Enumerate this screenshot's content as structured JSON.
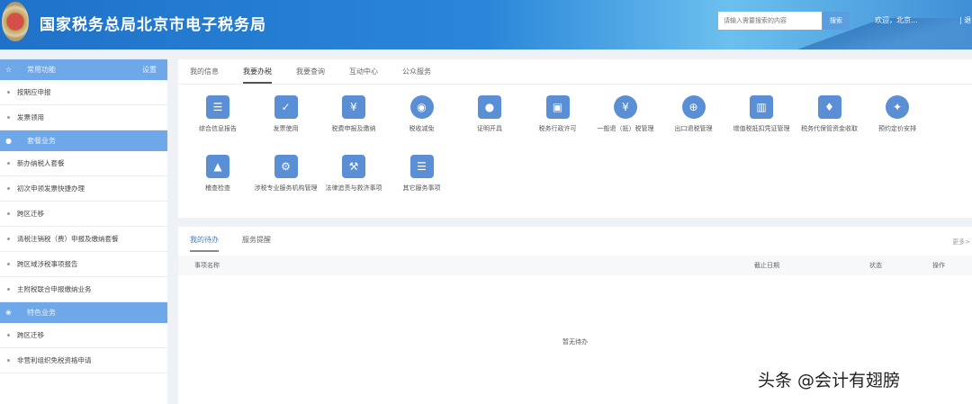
{
  "header": {
    "title": "国家税务总局北京市电子税务局",
    "search_placeholder": "请输入需要搜索的内容",
    "search_button": "搜索",
    "welcome": "欢迎，北京...",
    "logout": "| 退"
  },
  "sidebar": {
    "sections": [
      {
        "title": "常用功能",
        "action": "设置",
        "items": [
          "按期应申报",
          "发票领用"
        ]
      },
      {
        "title": "套餐业务",
        "items": [
          "新办纳税人套餐",
          "初次申领发票快捷办理",
          "跨区迁移",
          "清税注销税（费）申报及缴纳套餐",
          "跨区域涉税事项报告",
          "主附税联合申报缴纳业务"
        ]
      },
      {
        "title": "特色业务",
        "items": [
          "跨区迁移",
          "非营利组织免税资格申请"
        ]
      }
    ]
  },
  "main": {
    "tabs": [
      "我的信息",
      "我要办税",
      "我要查询",
      "互动中心",
      "公众服务"
    ],
    "active_tab": 1,
    "services": [
      {
        "label": "综合信息报告",
        "icon": "clipboard-icon",
        "glyph": "☰"
      },
      {
        "label": "发票使用",
        "icon": "invoice-check-icon",
        "glyph": "✓"
      },
      {
        "label": "税费申报及缴纳",
        "icon": "wallet-yuan-icon",
        "glyph": "¥"
      },
      {
        "label": "税收减免",
        "icon": "coin-icon",
        "glyph": "◉"
      },
      {
        "label": "证明开具",
        "icon": "ticket-icon",
        "glyph": "●"
      },
      {
        "label": "税务行政许可",
        "icon": "id-card-icon",
        "glyph": "▣"
      },
      {
        "label": "一般退（抵）税管理",
        "icon": "refund-cycle-icon",
        "glyph": "¥"
      },
      {
        "label": "出口退税管理",
        "icon": "globe-icon",
        "glyph": "⊕"
      },
      {
        "label": "增值税抵扣凭证管理",
        "icon": "ledger-icon",
        "glyph": "▥"
      },
      {
        "label": "税务代保管资金收取",
        "icon": "money-bag-hand-icon",
        "glyph": "♦"
      },
      {
        "label": "预约定价安排",
        "icon": "compass-icon",
        "glyph": "✦"
      },
      {
        "label": "稽查检查",
        "icon": "user-icon",
        "glyph": "▲"
      },
      {
        "label": "涉税专业服务机构管理",
        "icon": "user-gear-icon",
        "glyph": "⚙"
      },
      {
        "label": "法律追责与救济事项",
        "icon": "gavel-icon",
        "glyph": "⚒"
      },
      {
        "label": "其它服务事项",
        "icon": "clipboard-icon",
        "glyph": "☰"
      }
    ]
  },
  "todo": {
    "tabs": [
      "我的待办",
      "服务提醒"
    ],
    "more": "更多>",
    "columns": [
      "事项名称",
      "截止日期",
      "状态",
      "操作"
    ],
    "empty": "暂无待办"
  },
  "watermark": "头条 @会计有翅膀"
}
